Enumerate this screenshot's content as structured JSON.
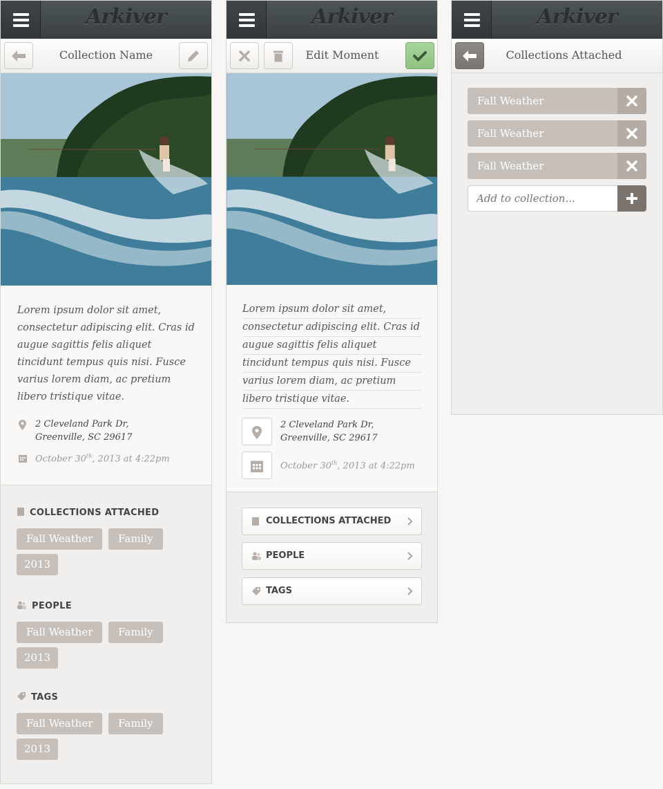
{
  "app": {
    "logo": "Arkiver"
  },
  "view_moment": {
    "title": "Collection Name",
    "description": "Lorem ipsum dolor sit amet, consectetur adipiscing elit. Cras id augue sagittis felis aliquet tincidunt tempus quis nisi. Fusce varius lorem diam, ac pretium libero tristique vitae.",
    "address_line1": "2 Cleveland Park Dr,",
    "address_line2": "Greenville, SC 29617",
    "date_pre": "October 30",
    "date_sup": "th",
    "date_post": ", 2013 at 4:22pm",
    "sections": [
      {
        "title": "COLLECTIONS ATTACHED",
        "icon": "bookmark-icon",
        "chips": [
          "Fall Weather",
          "Family",
          "2013"
        ]
      },
      {
        "title": "PEOPLE",
        "icon": "people-icon",
        "chips": [
          "Fall Weather",
          "Family",
          "2013"
        ]
      },
      {
        "title": "TAGS",
        "icon": "tag-icon",
        "chips": [
          "Fall Weather",
          "Family",
          "2013"
        ]
      }
    ]
  },
  "edit_moment": {
    "title": "Edit Moment",
    "description_lines": [
      "Lorem ipsum dolor sit amet,",
      "consectetur adipiscing elit. Cras id",
      "augue sagittis felis aliquet",
      "tincidunt tempus quis nisi. Fusce",
      "varius lorem diam, ac pretium",
      "libero tristique vitae."
    ],
    "address_line1": "2 Cleveland Park Dr,",
    "address_line2": "Greenville, SC 29617",
    "date_pre": "October 30",
    "date_sup": "th",
    "date_post": ", 2013 at 4:22pm",
    "nav": [
      "COLLECTIONS ATTACHED",
      "PEOPLE",
      "TAGS"
    ],
    "colors": {
      "save_button": "#9ccb8f"
    }
  },
  "collections_attached": {
    "title": "Collections Attached",
    "items": [
      "Fall Weather",
      "Fall Weather",
      "Fall Weather"
    ],
    "add_placeholder": "Add to collection..."
  }
}
